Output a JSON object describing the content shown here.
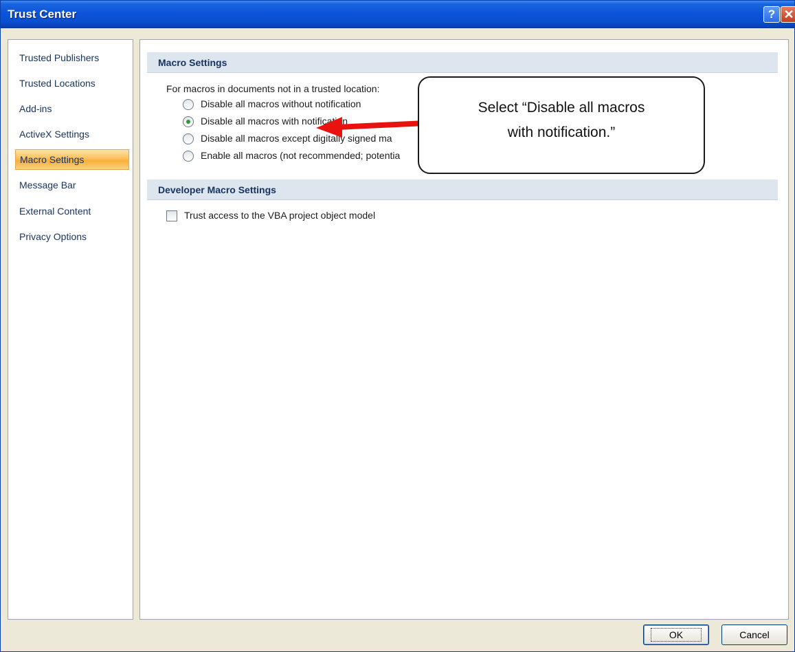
{
  "window": {
    "title": "Trust Center",
    "help_glyph": "?",
    "close_glyph": "✕"
  },
  "sidebar": {
    "items": [
      {
        "label": "Trusted Publishers",
        "selected": false
      },
      {
        "label": "Trusted Locations",
        "selected": false
      },
      {
        "label": "Add-ins",
        "selected": false
      },
      {
        "label": "ActiveX Settings",
        "selected": false
      },
      {
        "label": "Macro Settings",
        "selected": true
      },
      {
        "label": "Message Bar",
        "selected": false
      },
      {
        "label": "External Content",
        "selected": false
      },
      {
        "label": "Privacy Options",
        "selected": false
      }
    ]
  },
  "macro_settings": {
    "header": "Macro Settings",
    "intro": "For macros in documents not in a trusted location:",
    "options": [
      {
        "label": "Disable all macros without notification",
        "checked": false
      },
      {
        "label": "Disable all macros with notification",
        "checked": true
      },
      {
        "label": "Disable all macros except digitally signed ma",
        "checked": false
      },
      {
        "label": "Enable all macros (not recommended; potentia",
        "checked": false
      }
    ]
  },
  "developer_settings": {
    "header": "Developer Macro Settings",
    "trust_vba_label": "Trust access to the VBA project object model",
    "trust_vba_checked": false
  },
  "callout": {
    "line1": "Select “Disable all macros",
    "line2": "with notification.”",
    "arrow_color": "#e8130f"
  },
  "buttons": {
    "ok": "OK",
    "cancel": "Cancel"
  },
  "colors": {
    "titlebar": "#0a52d8",
    "selected_item": "#fbc05d",
    "section_header": "#dde5ef"
  }
}
